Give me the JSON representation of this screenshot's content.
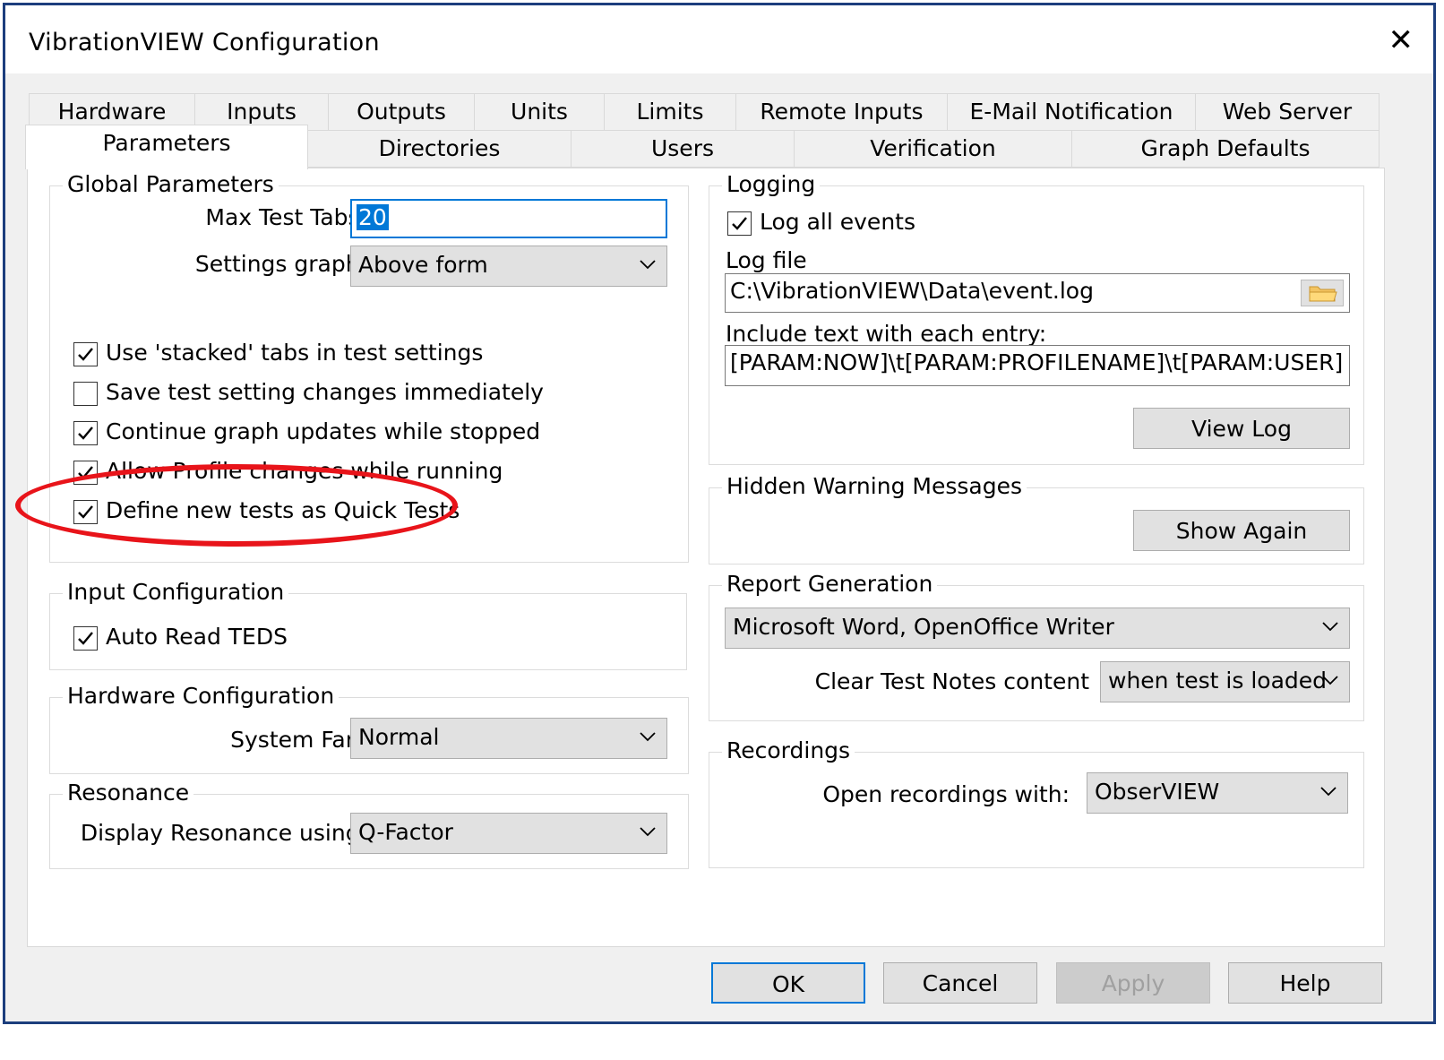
{
  "window": {
    "title": "VibrationVIEW Configuration"
  },
  "tabs_row1": [
    "Hardware",
    "Inputs",
    "Outputs",
    "Units",
    "Limits",
    "Remote Inputs",
    "E-Mail Notification",
    "Web Server"
  ],
  "tabs_row2": [
    "Parameters",
    "Directories",
    "Users",
    "Verification",
    "Graph Defaults"
  ],
  "global_parameters": {
    "title": "Global Parameters",
    "max_test_tabs_label": "Max Test Tabs:",
    "max_test_tabs_value": "20",
    "settings_graph_label": "Settings graph:",
    "settings_graph_value": "Above form",
    "checkboxes": [
      {
        "label": "Use 'stacked' tabs in test settings",
        "checked": true
      },
      {
        "label": "Save test setting changes immediately",
        "checked": false
      },
      {
        "label": "Continue graph updates while stopped",
        "checked": true
      },
      {
        "label": "Allow Profile changes while running",
        "checked": true
      },
      {
        "label": "Define new tests as Quick Tests",
        "checked": true
      }
    ]
  },
  "input_configuration": {
    "title": "Input Configuration",
    "auto_read_teds": {
      "label": "Auto Read TEDS",
      "checked": true
    }
  },
  "hardware_configuration": {
    "title": "Hardware Configuration",
    "system_fan_label": "System Fan:",
    "system_fan_value": "Normal"
  },
  "resonance": {
    "title": "Resonance",
    "display_label": "Display Resonance using:",
    "display_value": "Q-Factor"
  },
  "logging": {
    "title": "Logging",
    "log_all_events": {
      "label": "Log all events",
      "checked": true
    },
    "log_file_label": "Log file",
    "log_file_value": "C:\\VibrationVIEW\\Data\\event.log",
    "include_text_label": "Include text with each entry:",
    "include_text_value": "[PARAM:NOW]\\t[PARAM:PROFILENAME]\\t[PARAM:USER]",
    "view_log_button": "View Log"
  },
  "hidden_warning": {
    "title": "Hidden Warning Messages",
    "show_again_button": "Show Again"
  },
  "report_generation": {
    "title": "Report Generation",
    "report_app_value": "Microsoft Word, OpenOffice Writer",
    "clear_notes_label": "Clear Test Notes content",
    "clear_notes_value": "when test is loaded"
  },
  "recordings": {
    "title": "Recordings",
    "open_with_label": "Open recordings with:",
    "open_with_value": "ObserVIEW"
  },
  "footer": {
    "ok": "OK",
    "cancel": "Cancel",
    "apply": "Apply",
    "help": "Help"
  },
  "colors": {
    "accent": "#0078d7",
    "highlight": "#e8141a",
    "frame": "#1c3e7d"
  }
}
